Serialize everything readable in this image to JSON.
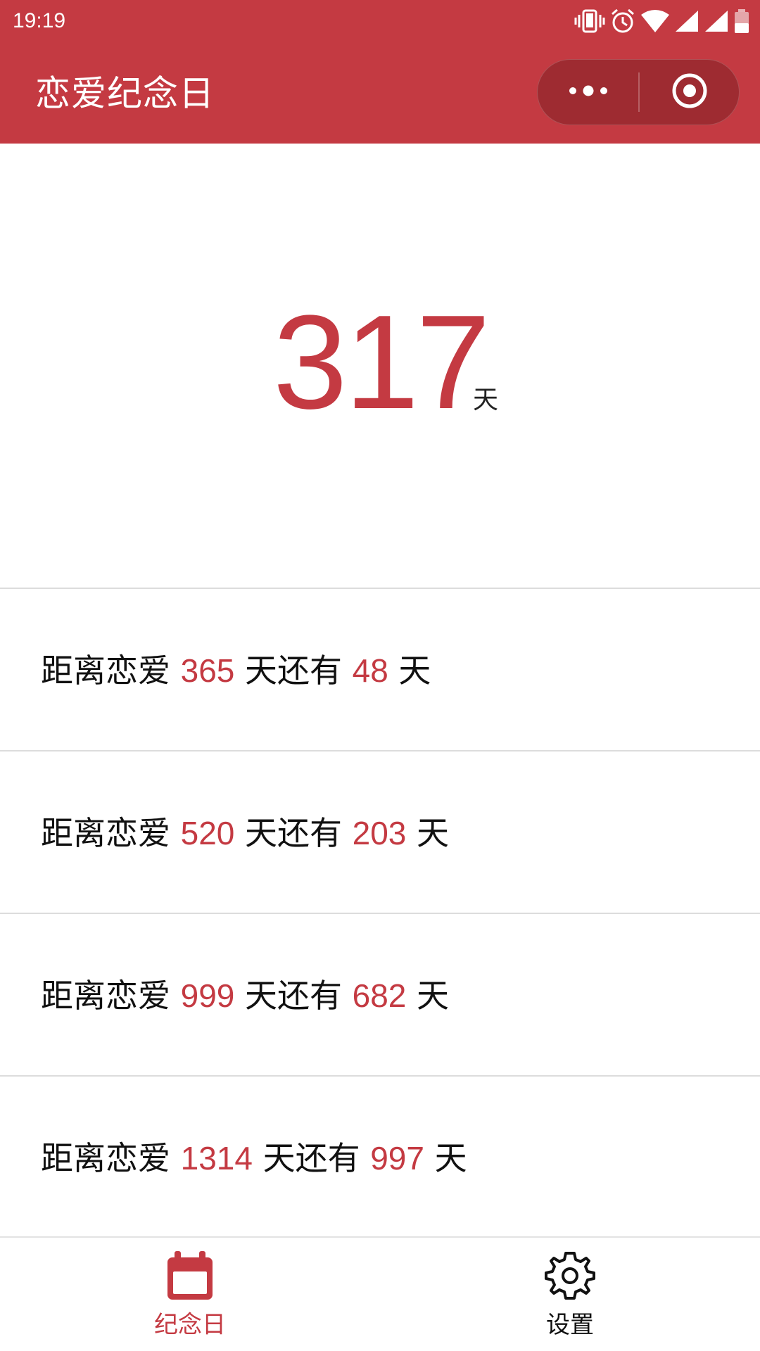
{
  "status_bar": {
    "time": "19:19"
  },
  "nav": {
    "title": "恋爱纪念日",
    "capsule": {
      "more_icon": "more-dots-icon",
      "close_icon": "target-circle-icon"
    }
  },
  "counter": {
    "days": "317",
    "unit": "天"
  },
  "milestones": [
    {
      "prefix": "距离恋爱 ",
      "target": "365",
      "middle": " 天还有 ",
      "remaining": "48",
      "suffix": " 天"
    },
    {
      "prefix": "距离恋爱 ",
      "target": "520",
      "middle": " 天还有 ",
      "remaining": "203",
      "suffix": " 天"
    },
    {
      "prefix": "距离恋爱 ",
      "target": "999",
      "middle": " 天还有 ",
      "remaining": "682",
      "suffix": " 天"
    },
    {
      "prefix": "距离恋爱 ",
      "target": "1314",
      "middle": " 天还有 ",
      "remaining": "997",
      "suffix": " 天"
    }
  ],
  "tabbar": {
    "tabs": [
      {
        "label": "纪念日",
        "icon": "calendar-icon",
        "active": true
      },
      {
        "label": "设置",
        "icon": "gear-icon",
        "active": false
      }
    ]
  },
  "colors": {
    "accent": "#c43a42",
    "capsule_bg": "#9e2b31",
    "text": "#111111",
    "divider": "#dcdcdc"
  }
}
